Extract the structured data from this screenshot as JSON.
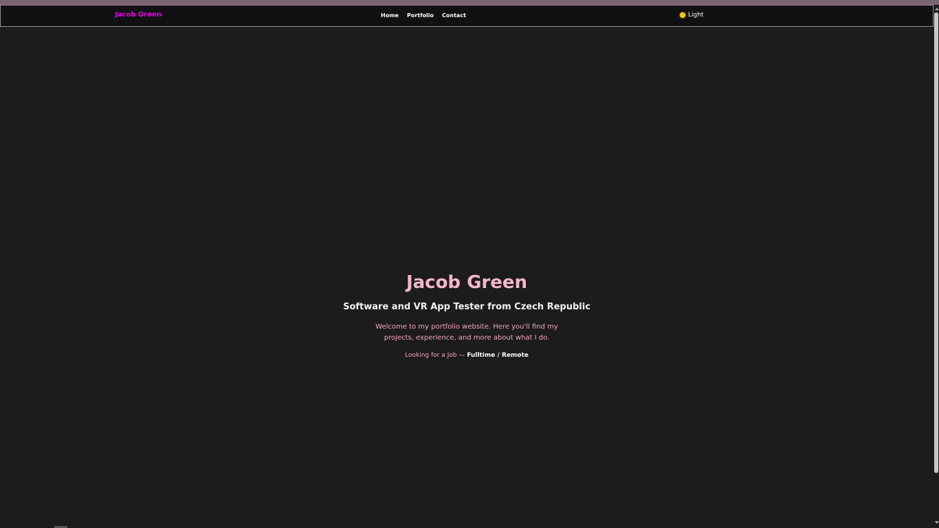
{
  "navbar": {
    "brand": "Jacob Green",
    "links": [
      "Home",
      "Portfolio",
      "Contact"
    ],
    "theme_toggle": {
      "icon": "sun-icon",
      "label": "Light"
    }
  },
  "hero": {
    "name": "Jacob Green",
    "subtitle": "Software and VR App Tester from Czech Republic",
    "welcome": "Welcome to my portfolio website. Here you'll find my projects, experience, and more about what I do.",
    "job_prefix": "Looking for a Job — ",
    "job_type": "Fulltime / Remote"
  },
  "colors": {
    "background": "#1c1b1d",
    "navbar_bg": "#111013",
    "brand": "#e600e6",
    "hero_name": "#f7b6cc",
    "accent_text": "#f5a7c3",
    "sun": "#f7c800"
  }
}
